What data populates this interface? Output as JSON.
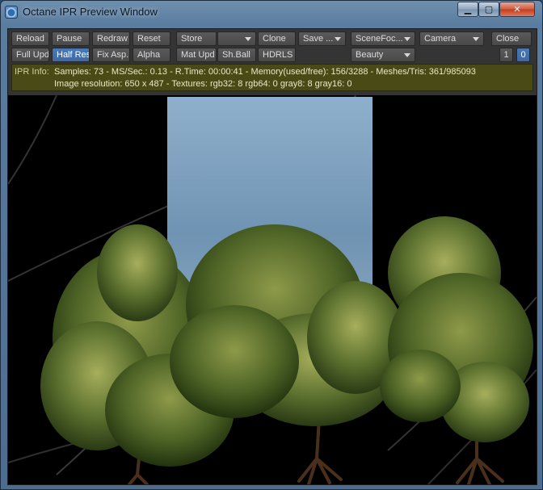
{
  "window": {
    "title": "Octane IPR Preview Window",
    "min_glyph": "▁",
    "max_glyph": "▢",
    "close_glyph": "✕"
  },
  "toolbar": {
    "row1": {
      "reload": "Reload",
      "pause": "Pause",
      "redraw": "Redraw",
      "reset": "Reset",
      "store": "Store",
      "store_dropdown": "",
      "clone": "Clone",
      "save": "Save ...",
      "scene_focus": "SceneFoc...",
      "camera": "Camera",
      "close": "Close"
    },
    "row2": {
      "full_upd": "Full Upd.",
      "half_res": "Half Res",
      "fix_asp": "Fix Asp.",
      "alpha": "Alpha",
      "mat_upd": "Mat Upd",
      "sh_ball": "Sh.Ball",
      "hdrls": "HDRLS",
      "pass": "Beauty",
      "page_1": "1",
      "page_0": "0"
    }
  },
  "ipr_info": {
    "label": "IPR Info:",
    "line1": "Samples: 73  -  MS/Sec.: 0.13  -  R.Time: 00:00:41 - Memory(used/free): 156/3288  -  Meshes/Tris: 361/985093",
    "line2": "Image resolution: 650 x 487 - Textures:  rgb32: 8   rgb64: 0   gray8: 8   gray16: 0"
  },
  "colors": {
    "accent": "#3d6aa5",
    "info_bg": "#4a4a16",
    "panel_bg": "#343434"
  }
}
